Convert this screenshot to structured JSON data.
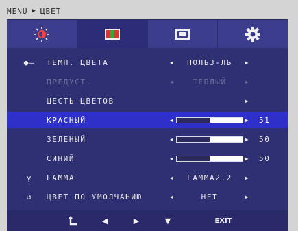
{
  "breadcrumb": {
    "root": "MENU",
    "current": "ЦВЕТ"
  },
  "tabs": [
    {
      "icon": "brightness-icon"
    },
    {
      "icon": "color-icon"
    },
    {
      "icon": "screen-icon"
    },
    {
      "icon": "settings-icon"
    }
  ],
  "menu": {
    "color_temp": {
      "label": "ТЕМП. ЦВЕТА",
      "value": "ПОЛЬЗ-ЛЬ",
      "icon": "color-temp-icon"
    },
    "preset": {
      "label": "ПРЕДУСТ.",
      "value": "ТЕПЛЫЙ"
    },
    "six_colors": {
      "label": "ШЕСТЬ ЦВЕТОВ"
    },
    "red": {
      "label": "КРАСНЫЙ",
      "value": "51",
      "level": 51
    },
    "green": {
      "label": "ЗЕЛЕНЫЙ",
      "value": "50",
      "level": 50
    },
    "blue": {
      "label": "СИНИЙ",
      "value": "50",
      "level": 50
    },
    "gamma": {
      "label": "ГАММА",
      "value": "ГАММА2.2",
      "icon": "gamma-icon"
    },
    "reset": {
      "label": "ЦВЕТ ПО УМОЛЧАНИЮ",
      "value": "НЕТ",
      "icon": "reset-icon"
    }
  },
  "bottom_bar": {
    "back_icon": "back-icon",
    "left_icon": "left-arrow-icon",
    "right_icon": "right-arrow-icon",
    "down_icon": "down-arrow-icon",
    "exit_label": "EXIT"
  },
  "colors": {
    "panel": "#2f2f73",
    "selected": "#2e30c9",
    "tabs": "#3d3d8e"
  }
}
